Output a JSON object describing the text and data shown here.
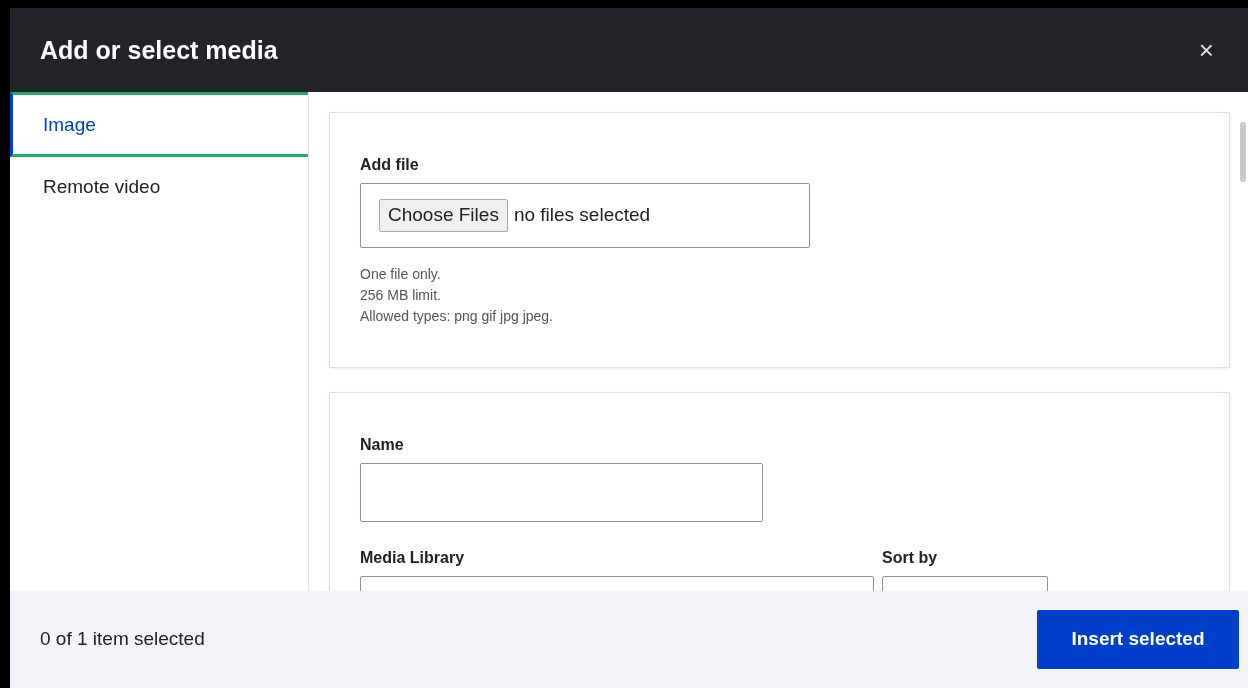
{
  "dialog": {
    "title": "Add or select media",
    "close": "×"
  },
  "tabs": [
    {
      "label": "Image",
      "selected": true
    },
    {
      "label": "Remote video",
      "selected": false
    }
  ],
  "upload": {
    "label": "Add file",
    "button": "Choose Files",
    "status": "no files selected",
    "help": [
      "One file only.",
      "256 MB limit.",
      "Allowed types: png gif jpg jpeg."
    ]
  },
  "filters": {
    "name_label": "Name",
    "media_library_label": "Media Library",
    "sort_label": "Sort by"
  },
  "footer": {
    "selection": "0 of 1 item selected",
    "insert_button": "Insert selected"
  }
}
